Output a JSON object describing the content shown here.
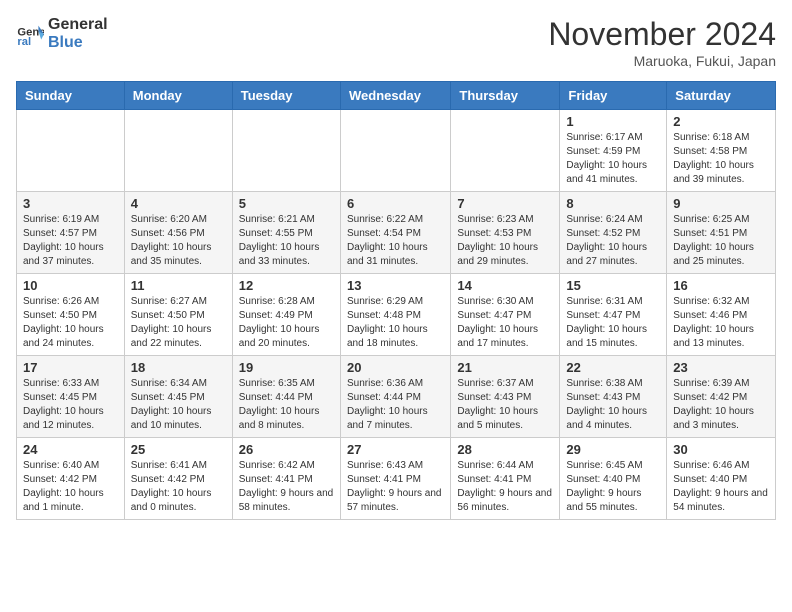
{
  "header": {
    "logo_line1": "General",
    "logo_line2": "Blue",
    "month_title": "November 2024",
    "location": "Maruoka, Fukui, Japan"
  },
  "days_of_week": [
    "Sunday",
    "Monday",
    "Tuesday",
    "Wednesday",
    "Thursday",
    "Friday",
    "Saturday"
  ],
  "weeks": [
    [
      null,
      null,
      null,
      null,
      null,
      {
        "day": "1",
        "sunrise": "Sunrise: 6:17 AM",
        "sunset": "Sunset: 4:59 PM",
        "daylight": "Daylight: 10 hours and 41 minutes."
      },
      {
        "day": "2",
        "sunrise": "Sunrise: 6:18 AM",
        "sunset": "Sunset: 4:58 PM",
        "daylight": "Daylight: 10 hours and 39 minutes."
      }
    ],
    [
      {
        "day": "3",
        "sunrise": "Sunrise: 6:19 AM",
        "sunset": "Sunset: 4:57 PM",
        "daylight": "Daylight: 10 hours and 37 minutes."
      },
      {
        "day": "4",
        "sunrise": "Sunrise: 6:20 AM",
        "sunset": "Sunset: 4:56 PM",
        "daylight": "Daylight: 10 hours and 35 minutes."
      },
      {
        "day": "5",
        "sunrise": "Sunrise: 6:21 AM",
        "sunset": "Sunset: 4:55 PM",
        "daylight": "Daylight: 10 hours and 33 minutes."
      },
      {
        "day": "6",
        "sunrise": "Sunrise: 6:22 AM",
        "sunset": "Sunset: 4:54 PM",
        "daylight": "Daylight: 10 hours and 31 minutes."
      },
      {
        "day": "7",
        "sunrise": "Sunrise: 6:23 AM",
        "sunset": "Sunset: 4:53 PM",
        "daylight": "Daylight: 10 hours and 29 minutes."
      },
      {
        "day": "8",
        "sunrise": "Sunrise: 6:24 AM",
        "sunset": "Sunset: 4:52 PM",
        "daylight": "Daylight: 10 hours and 27 minutes."
      },
      {
        "day": "9",
        "sunrise": "Sunrise: 6:25 AM",
        "sunset": "Sunset: 4:51 PM",
        "daylight": "Daylight: 10 hours and 25 minutes."
      }
    ],
    [
      {
        "day": "10",
        "sunrise": "Sunrise: 6:26 AM",
        "sunset": "Sunset: 4:50 PM",
        "daylight": "Daylight: 10 hours and 24 minutes."
      },
      {
        "day": "11",
        "sunrise": "Sunrise: 6:27 AM",
        "sunset": "Sunset: 4:50 PM",
        "daylight": "Daylight: 10 hours and 22 minutes."
      },
      {
        "day": "12",
        "sunrise": "Sunrise: 6:28 AM",
        "sunset": "Sunset: 4:49 PM",
        "daylight": "Daylight: 10 hours and 20 minutes."
      },
      {
        "day": "13",
        "sunrise": "Sunrise: 6:29 AM",
        "sunset": "Sunset: 4:48 PM",
        "daylight": "Daylight: 10 hours and 18 minutes."
      },
      {
        "day": "14",
        "sunrise": "Sunrise: 6:30 AM",
        "sunset": "Sunset: 4:47 PM",
        "daylight": "Daylight: 10 hours and 17 minutes."
      },
      {
        "day": "15",
        "sunrise": "Sunrise: 6:31 AM",
        "sunset": "Sunset: 4:47 PM",
        "daylight": "Daylight: 10 hours and 15 minutes."
      },
      {
        "day": "16",
        "sunrise": "Sunrise: 6:32 AM",
        "sunset": "Sunset: 4:46 PM",
        "daylight": "Daylight: 10 hours and 13 minutes."
      }
    ],
    [
      {
        "day": "17",
        "sunrise": "Sunrise: 6:33 AM",
        "sunset": "Sunset: 4:45 PM",
        "daylight": "Daylight: 10 hours and 12 minutes."
      },
      {
        "day": "18",
        "sunrise": "Sunrise: 6:34 AM",
        "sunset": "Sunset: 4:45 PM",
        "daylight": "Daylight: 10 hours and 10 minutes."
      },
      {
        "day": "19",
        "sunrise": "Sunrise: 6:35 AM",
        "sunset": "Sunset: 4:44 PM",
        "daylight": "Daylight: 10 hours and 8 minutes."
      },
      {
        "day": "20",
        "sunrise": "Sunrise: 6:36 AM",
        "sunset": "Sunset: 4:44 PM",
        "daylight": "Daylight: 10 hours and 7 minutes."
      },
      {
        "day": "21",
        "sunrise": "Sunrise: 6:37 AM",
        "sunset": "Sunset: 4:43 PM",
        "daylight": "Daylight: 10 hours and 5 minutes."
      },
      {
        "day": "22",
        "sunrise": "Sunrise: 6:38 AM",
        "sunset": "Sunset: 4:43 PM",
        "daylight": "Daylight: 10 hours and 4 minutes."
      },
      {
        "day": "23",
        "sunrise": "Sunrise: 6:39 AM",
        "sunset": "Sunset: 4:42 PM",
        "daylight": "Daylight: 10 hours and 3 minutes."
      }
    ],
    [
      {
        "day": "24",
        "sunrise": "Sunrise: 6:40 AM",
        "sunset": "Sunset: 4:42 PM",
        "daylight": "Daylight: 10 hours and 1 minute."
      },
      {
        "day": "25",
        "sunrise": "Sunrise: 6:41 AM",
        "sunset": "Sunset: 4:42 PM",
        "daylight": "Daylight: 10 hours and 0 minutes."
      },
      {
        "day": "26",
        "sunrise": "Sunrise: 6:42 AM",
        "sunset": "Sunset: 4:41 PM",
        "daylight": "Daylight: 9 hours and 58 minutes."
      },
      {
        "day": "27",
        "sunrise": "Sunrise: 6:43 AM",
        "sunset": "Sunset: 4:41 PM",
        "daylight": "Daylight: 9 hours and 57 minutes."
      },
      {
        "day": "28",
        "sunrise": "Sunrise: 6:44 AM",
        "sunset": "Sunset: 4:41 PM",
        "daylight": "Daylight: 9 hours and 56 minutes."
      },
      {
        "day": "29",
        "sunrise": "Sunrise: 6:45 AM",
        "sunset": "Sunset: 4:40 PM",
        "daylight": "Daylight: 9 hours and 55 minutes."
      },
      {
        "day": "30",
        "sunrise": "Sunrise: 6:46 AM",
        "sunset": "Sunset: 4:40 PM",
        "daylight": "Daylight: 9 hours and 54 minutes."
      }
    ]
  ]
}
